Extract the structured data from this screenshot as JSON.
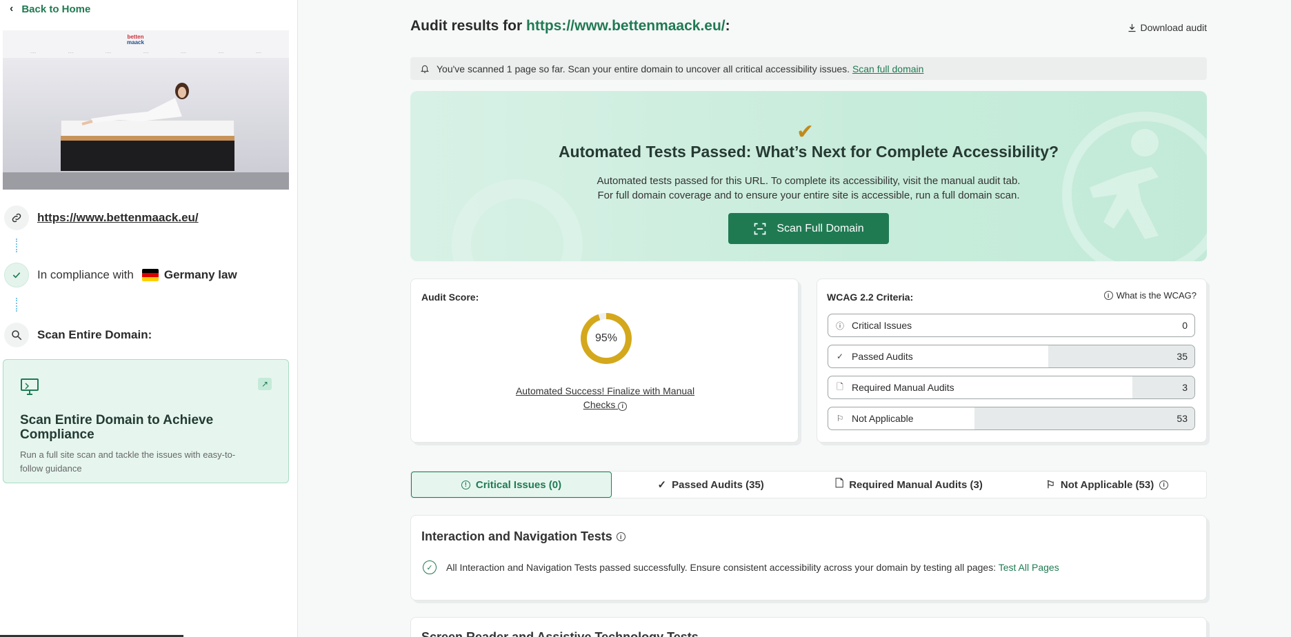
{
  "sidebar": {
    "back_label": "Back to Home",
    "site_url": "https://www.bettenmaack.eu/",
    "compliance_prefix": "In compliance with",
    "compliance_law": "Germany law",
    "scan_heading": "Scan Entire Domain:",
    "scan_card": {
      "title": "Scan Entire Domain to Achieve Compliance",
      "description": "Run a full site scan and tackle the issues with easy-to-follow guidance"
    }
  },
  "header": {
    "title_prefix": "Audit results for",
    "url": "https://www.bettenmaack.eu/",
    "title_suffix": ":",
    "download_label": "Download audit"
  },
  "notice": {
    "text": "You've scanned 1 page so far. Scan your entire domain to uncover all critical accessibility issues.",
    "link": "Scan full domain"
  },
  "hero": {
    "title": "Automated Tests Passed: What’s Next for Complete Accessibility?",
    "line1": "Automated tests passed for this URL. To complete its accessibility, visit the manual audit tab.",
    "line2": "For full domain coverage and to ensure your entire site is accessible, run a full domain scan.",
    "button": "Scan Full Domain"
  },
  "score": {
    "label": "Audit Score:",
    "value": "95%",
    "percent": 95,
    "message": "Automated Success! Finalize with Manual Checks"
  },
  "wcag": {
    "label": "WCAG 2.2 Criteria:",
    "help": "What is the WCAG?",
    "rows": [
      {
        "label": "Critical Issues",
        "value": "0",
        "fill": 0
      },
      {
        "label": "Passed Audits",
        "value": "35",
        "fill": 0.4
      },
      {
        "label": "Required Manual Audits",
        "value": "3",
        "fill": 0.17
      },
      {
        "label": "Not Applicable",
        "value": "53",
        "fill": 0.6
      }
    ]
  },
  "tabs": [
    {
      "label": "Critical Issues (0)"
    },
    {
      "label": "Passed Audits (35)"
    },
    {
      "label": "Required Manual Audits (3)"
    },
    {
      "label": "Not Applicable (53)"
    }
  ],
  "sections": {
    "interaction_title": "Interaction and Navigation Tests",
    "interaction_text": "All Interaction and Navigation Tests passed successfully. Ensure consistent accessibility across your domain by testing all pages:",
    "interaction_link": "Test All Pages",
    "screen_reader_title": "Screen Reader and Assistive Technology Tests"
  },
  "colors": {
    "accent": "#1f7a52",
    "score": "#d4a81c"
  }
}
